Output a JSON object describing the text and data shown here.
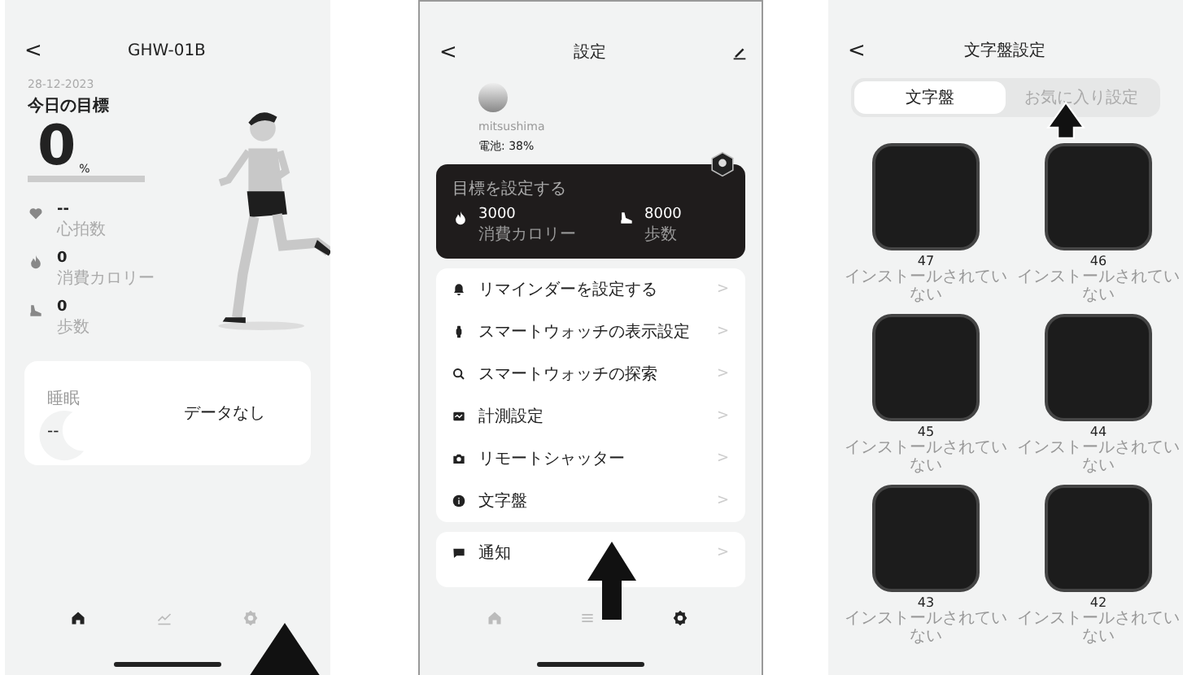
{
  "screens": [
    {
      "kind": "home",
      "header": {
        "back": "<",
        "title": "GHW-01B"
      },
      "date": "28-12-2023",
      "goal_label": "今日の目標",
      "goal_value": "0",
      "goal_unit": "%",
      "stats": [
        {
          "kind": "heart",
          "value": "--",
          "label": "心拍数"
        },
        {
          "kind": "flame",
          "value": "0",
          "label": "消費カロリー"
        },
        {
          "kind": "shoe",
          "value": "0",
          "label": "歩数"
        }
      ],
      "sleep": {
        "title": "睡眠",
        "value": "--",
        "message": "データなし"
      },
      "tab_bar": [
        {
          "kind": "home",
          "selected": true
        },
        {
          "kind": "chart",
          "selected": false
        },
        {
          "kind": "settings",
          "selected": false
        }
      ]
    },
    {
      "kind": "settings",
      "header": {
        "back": "<",
        "title": "設定"
      },
      "username": "mitsushima",
      "battery": "電池: 38%",
      "goal_card": {
        "title": "目標を設定する",
        "items": [
          {
            "kind": "flame",
            "value": "3000",
            "label": "消費カロリー"
          },
          {
            "kind": "shoe",
            "value": "8000",
            "label": "歩数"
          }
        ]
      },
      "menu": [
        {
          "kind": "bell",
          "label": "リマインダーを設定する",
          "chevron": ">"
        },
        {
          "kind": "watch",
          "label": "スマートウォッチの表示設定",
          "chevron": ">"
        },
        {
          "kind": "search",
          "label": "スマートウォッチの探索",
          "chevron": ">"
        },
        {
          "kind": "monitor",
          "label": "計測設定",
          "chevron": ">"
        },
        {
          "kind": "camera",
          "label": "リモートシャッター",
          "chevron": ">"
        },
        {
          "kind": "info",
          "label": "文字盤",
          "chevron": ">"
        }
      ],
      "menu2": [
        {
          "kind": "message",
          "label": "通知",
          "chevron": ">"
        }
      ],
      "tab_bar": [
        {
          "kind": "home",
          "selected": false
        },
        {
          "kind": "list",
          "selected": false
        },
        {
          "kind": "settings",
          "selected": true
        }
      ]
    },
    {
      "kind": "faces",
      "header": {
        "back": "<",
        "title": "文字盤設定"
      },
      "segments": [
        {
          "label": "文字盤",
          "selected": true
        },
        {
          "label": "お気に入り設定",
          "selected": false
        }
      ],
      "faces": [
        {
          "number": "47",
          "status": "インストールされていない"
        },
        {
          "number": "46",
          "status": "インストールされていない"
        },
        {
          "number": "45",
          "status": "インストールされていない"
        },
        {
          "number": "44",
          "status": "インストールされていない"
        },
        {
          "number": "43",
          "status": "インストールされていない"
        },
        {
          "number": "42",
          "status": "インストールされていない"
        }
      ]
    }
  ]
}
